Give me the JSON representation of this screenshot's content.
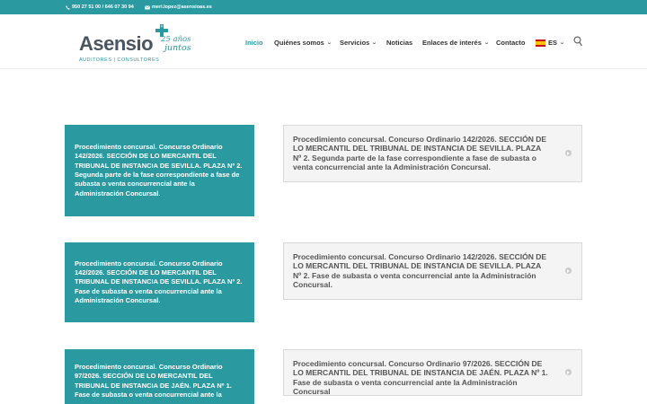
{
  "topbar": {
    "phone": "950 27 51 00 / 646 07 30 94",
    "email": "meri.lopez@asensioas.es"
  },
  "logo": {
    "brand": "Asensio",
    "anniversary_line1": "25 años",
    "anniversary_line2": "juntos",
    "tagline": "AUDITORES | CONSULTORES"
  },
  "nav": {
    "items": [
      {
        "label": "Inicio",
        "active": true
      },
      {
        "label": "Quiénes somos",
        "dropdown": true
      },
      {
        "label": "Servicios",
        "dropdown": true
      },
      {
        "label": "Noticias"
      },
      {
        "label": "Enlaces de interés",
        "dropdown": true
      },
      {
        "label": "Contacto"
      },
      {
        "label": "ES",
        "dropdown": true,
        "icon": "spain-flag-icon"
      }
    ],
    "search_icon": "search-icon"
  },
  "colors": {
    "accent": "#2b9aa0",
    "text": "#333333",
    "toggle_bg": "#f4f4f4"
  },
  "rows": [
    {
      "card": "Procedimiento concursal. Concurso Ordinario 142/2026. SECCIÓN DE LO MERCANTIL DEL TRIBUNAL DE INSTANCIA DE SEVILLA. PLAZA Nº 2. Segunda parte de la fase correspondiente a fase de subasta o venta concurrencial ante la Administración Concursal.",
      "toggle": "Procedimiento concursal. Concurso Ordinario 142/2026. SECCIÓN DE LO MERCANTIL DEL TRIBUNAL DE INSTANCIA DE SEVILLA. PLAZA Nº 2. Segunda parte de la fase correspondiente a fase de subasta o venta concurrencial ante la Administración Concursal."
    },
    {
      "card": "Procedimiento concursal. Concurso Ordinario 142/2026. SECCIÓN DE LO MERCANTIL DEL TRIBUNAL DE INSTANCIA DE SEVILLA. PLAZA Nº 2. Fase de subasta o venta concurrencial ante la Administración Concursal.",
      "toggle": "Procedimiento concursal. Concurso Ordinario 142/2026. SECCIÓN DE LO MERCANTIL DEL TRIBUNAL DE INSTANCIA DE SEVILLA. PLAZA Nº 2. Fase de subasta o venta concurrencial ante la Administración Concursal."
    },
    {
      "card": "Procedimiento concursal. Concurso Ordinario 97/2026. SECCIÓN DE LO MERCANTIL DEL TRIBUNAL DE INSTANCIA DE JAÉN. PLAZA Nº 1. Fase de subasta o venta concurrencial ante la",
      "toggle": "Procedimiento concursal. Concurso Ordinario 97/2026. SECCIÓN DE LO MERCANTIL DEL TRIBUNAL DE INSTANCIA DE JAÉN. PLAZA Nº 1. Fase de subasta o venta concurrencial ante la Administración Concursal"
    }
  ]
}
